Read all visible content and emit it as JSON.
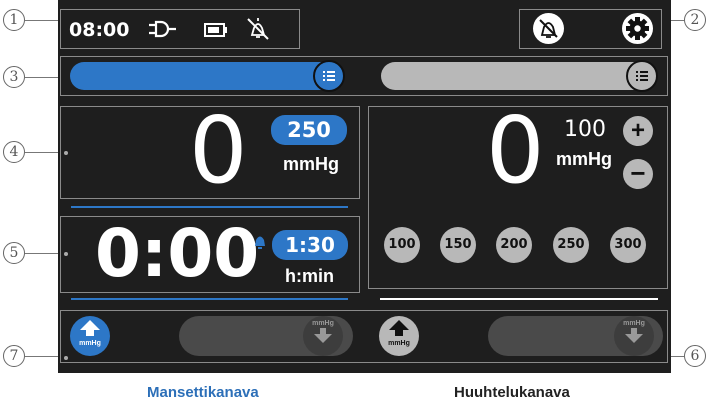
{
  "status": {
    "time": "08:00",
    "icons": [
      "plug-icon",
      "battery-icon",
      "alarm-mute-icon"
    ]
  },
  "top_right": {
    "icons": [
      "alarm-mute-icon",
      "gear-icon"
    ]
  },
  "callouts": [
    "1",
    "2",
    "3",
    "4",
    "5",
    "6",
    "7"
  ],
  "cuff": {
    "pressure_value": "0",
    "target_pressure": "250",
    "pressure_unit": "mmHg",
    "timer_value": "0:00",
    "timer_target": "1:30",
    "timer_unit": "h:min",
    "bar_color": "#2d77c7"
  },
  "deflation": {
    "pressure_value": "0",
    "target_pressure": "100",
    "pressure_unit": "mmHg",
    "presets": [
      "100",
      "150",
      "200",
      "250",
      "300"
    ]
  },
  "controls": {
    "left_inflate_label": "mmHg",
    "left_slider_label": "mmHg",
    "right_inflate_label": "mmHg",
    "right_slider_label": "mmHg"
  },
  "captions": {
    "left": "Mansettikanava",
    "right": "Huuhtelukanava"
  },
  "colors": {
    "accent_blue": "#2d77c7",
    "caption_blue": "#2c6fb8",
    "panel_bg": "#1e1e1e"
  }
}
